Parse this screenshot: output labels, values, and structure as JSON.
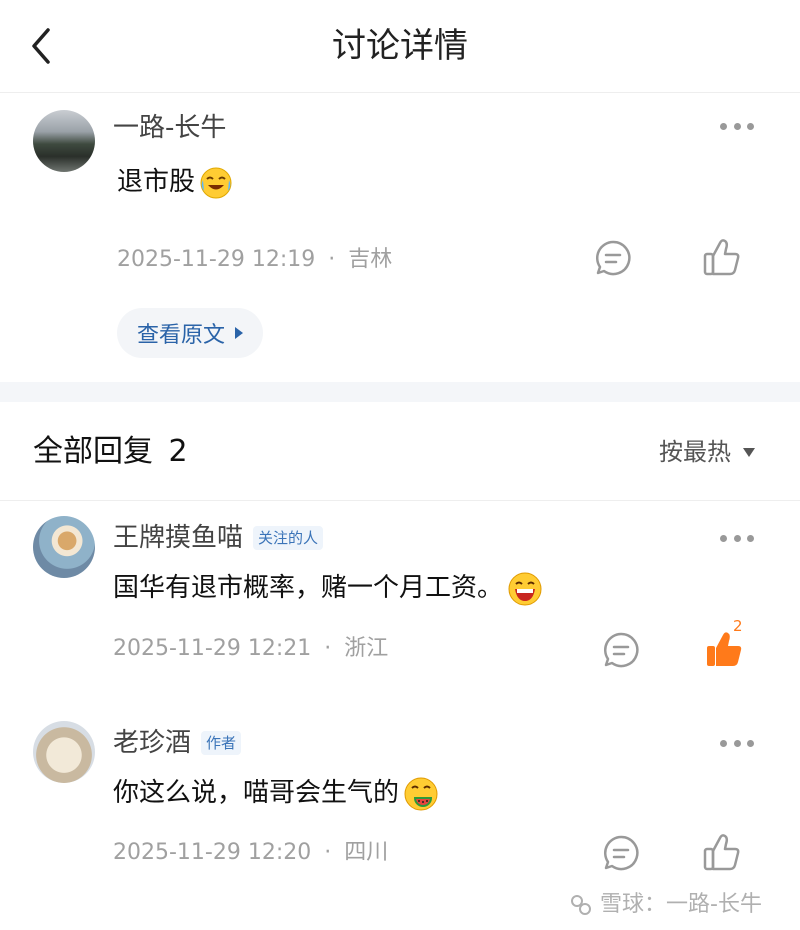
{
  "header": {
    "title": "讨论详情"
  },
  "post": {
    "username": "一路-长牛",
    "content": "退市股",
    "emoji": "crying-laughing-emoji",
    "timestamp": "2025-11-29 12:19",
    "location": "吉林",
    "view_original_label": "查看原文"
  },
  "replies": {
    "title_label": "全部回复",
    "count": "2",
    "sort_label": "按最热",
    "items": [
      {
        "username": "王牌摸鱼喵",
        "tag": "关注的人",
        "content": "国华有退市概率，赌一个月工资。",
        "emoji": "grinning-emoji",
        "timestamp": "2025-11-29 12:21",
        "location": "浙江",
        "like_count": "2",
        "liked": true
      },
      {
        "username": "老珍酒",
        "tag": "作者",
        "content": "你这么说，喵哥会生气的",
        "emoji": "watermelon-eating-emoji",
        "timestamp": "2025-11-29 12:20",
        "location": "四川",
        "liked": false
      }
    ]
  },
  "watermark": {
    "text": "雪球：一路-长牛"
  },
  "separator": "·",
  "colors": {
    "accent": "#2a63a8",
    "liked": "#ff7a1a",
    "meta": "#a0a0a0"
  }
}
